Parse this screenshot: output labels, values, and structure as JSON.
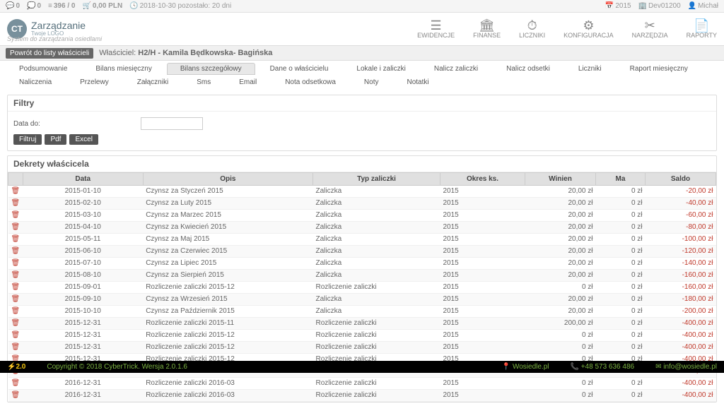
{
  "topbar": {
    "comments": "0",
    "messages": "0",
    "feed": "396 / 0",
    "balance": "0,00 PLN",
    "date": "2018-10-30 pozostało: 20 dni",
    "year": "2015",
    "dev": "Dev01200",
    "user": "Michał"
  },
  "logo": {
    "badge": "CT",
    "title": "Zarządzanie",
    "subtitle": "Twoje LOGO"
  },
  "tagline": "System do zarządzania osiedlami",
  "nav": {
    "ewidencje": "EWIDENCJE",
    "finanse": "FINANSE",
    "liczniki": "LICZNIKI",
    "konfiguracja": "KONFIGURACJA",
    "narzedzia": "NARZĘDZIA",
    "raporty": "RAPORTY"
  },
  "owner": {
    "back": "Powrót do listy właścicieli",
    "label": "Właściciel:",
    "value": "H2/H - Kamila Będkowska- Bagińska"
  },
  "tabs": [
    "Podsumowanie",
    "Bilans miesięczny",
    "Bilans szczegółowy",
    "Dane o właścicielu",
    "Lokale i zaliczki",
    "Nalicz zaliczki",
    "Nalicz odsetki",
    "Liczniki",
    "Raport miesięczny",
    "Naliczenia",
    "Przelewy",
    "Załączniki",
    "Sms",
    "Email",
    "Nota odsetkowa",
    "Noty",
    "Notatki"
  ],
  "active_tab": 2,
  "filters": {
    "heading": "Filtry",
    "label": "Data do:",
    "value": "",
    "btn_filter": "Filtruj",
    "btn_pdf": "Pdf",
    "btn_excel": "Excel"
  },
  "dekrety": {
    "heading": "Dekrety właścicela",
    "cols": [
      "",
      "Data",
      "Opis",
      "Typ zaliczki",
      "Okres ks.",
      "Winien",
      "Ma",
      "Saldo"
    ],
    "rows": [
      [
        "2015-01-10",
        "Czynsz za Styczeń 2015",
        "Zaliczka",
        "2015",
        "20,00 zł",
        "0 zł",
        "-20,00 zł"
      ],
      [
        "2015-02-10",
        "Czynsz za Luty 2015",
        "Zaliczka",
        "2015",
        "20,00 zł",
        "0 zł",
        "-40,00 zł"
      ],
      [
        "2015-03-10",
        "Czynsz za Marzec 2015",
        "Zaliczka",
        "2015",
        "20,00 zł",
        "0 zł",
        "-60,00 zł"
      ],
      [
        "2015-04-10",
        "Czynsz za Kwiecień 2015",
        "Zaliczka",
        "2015",
        "20,00 zł",
        "0 zł",
        "-80,00 zł"
      ],
      [
        "2015-05-11",
        "Czynsz za Maj 2015",
        "Zaliczka",
        "2015",
        "20,00 zł",
        "0 zł",
        "-100,00 zł"
      ],
      [
        "2015-06-10",
        "Czynsz za Czerwiec 2015",
        "Zaliczka",
        "2015",
        "20,00 zł",
        "0 zł",
        "-120,00 zł"
      ],
      [
        "2015-07-10",
        "Czynsz za Lipiec 2015",
        "Zaliczka",
        "2015",
        "20,00 zł",
        "0 zł",
        "-140,00 zł"
      ],
      [
        "2015-08-10",
        "Czynsz za Sierpień 2015",
        "Zaliczka",
        "2015",
        "20,00 zł",
        "0 zł",
        "-160,00 zł"
      ],
      [
        "2015-09-01",
        "Rozliczenie zaliczki 2015-12",
        "Rozliczenie zaliczki",
        "2015",
        "0 zł",
        "0 zł",
        "-160,00 zł"
      ],
      [
        "2015-09-10",
        "Czynsz za Wrzesień 2015",
        "Zaliczka",
        "2015",
        "20,00 zł",
        "0 zł",
        "-180,00 zł"
      ],
      [
        "2015-10-10",
        "Czynsz za Październik 2015",
        "Zaliczka",
        "2015",
        "20,00 zł",
        "0 zł",
        "-200,00 zł"
      ],
      [
        "2015-12-31",
        "Rozliczenie zaliczki 2015-11",
        "Rozliczenie zaliczki",
        "2015",
        "200,00 zł",
        "0 zł",
        "-400,00 zł"
      ],
      [
        "2015-12-31",
        "Rozliczenie zaliczki 2015-12",
        "Rozliczenie zaliczki",
        "2015",
        "0 zł",
        "0 zł",
        "-400,00 zł"
      ],
      [
        "2015-12-31",
        "Rozliczenie zaliczki 2015-12",
        "Rozliczenie zaliczki",
        "2015",
        "0 zł",
        "0 zł",
        "-400,00 zł"
      ],
      [
        "2015-12-31",
        "Rozliczenie zaliczki 2015-12",
        "Rozliczenie zaliczki",
        "2015",
        "0 zł",
        "0 zł",
        "-400,00 zł"
      ],
      [
        "2015-12-31",
        "Rozliczenie zaliczki 2015-12",
        "Rozliczenie zaliczki",
        "2015",
        "0 zł",
        "0 zł",
        "-400,00 zł"
      ],
      [
        "2016-12-31",
        "Rozliczenie zaliczki 2016-03",
        "Rozliczenie zaliczki",
        "2015",
        "0 zł",
        "0 zł",
        "-400,00 zł"
      ],
      [
        "2016-12-31",
        "Rozliczenie zaliczki 2016-03",
        "Rozliczenie zaliczki",
        "2015",
        "0 zł",
        "0 zł",
        "-400,00 zł"
      ]
    ]
  },
  "footer": {
    "ver_prefix": "2.0",
    "copyright": "Copyright © 2018 CyberTrick. Wersja 2.0.1.6",
    "site": "Wosiedle.pl",
    "phone": "+48 573 636 486",
    "email": "info@wosiedle.pl"
  }
}
